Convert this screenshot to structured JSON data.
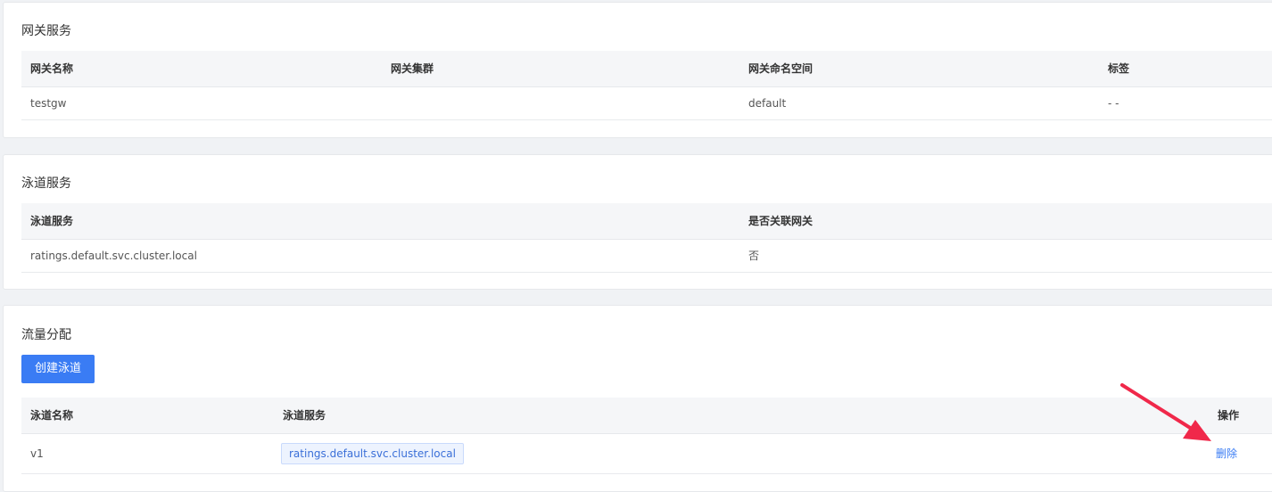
{
  "gateway_section": {
    "title": "网关服务",
    "columns": [
      "网关名称",
      "网关集群",
      "网关命名空间",
      "标签"
    ],
    "rows": [
      {
        "name": "testgw",
        "cluster": "",
        "namespace": "default",
        "labels": "- -"
      }
    ]
  },
  "lane_service_section": {
    "title": "泳道服务",
    "columns": [
      "泳道服务",
      "是否关联网关"
    ],
    "rows": [
      {
        "service": "ratings.default.svc.cluster.local",
        "linked": "否"
      }
    ]
  },
  "traffic_section": {
    "title": "流量分配",
    "create_button": "创建泳道",
    "columns": [
      "泳道名称",
      "泳道服务",
      "操作"
    ],
    "rows": [
      {
        "lane": "v1",
        "service": "ratings.default.svc.cluster.local",
        "action": "删除"
      }
    ]
  },
  "colors": {
    "primary": "#3a7cf4",
    "annotation_arrow": "#f0284a"
  }
}
